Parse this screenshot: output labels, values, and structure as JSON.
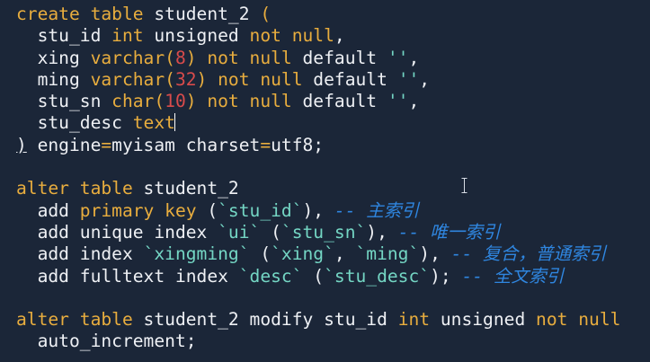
{
  "code": [
    [
      {
        "t": "create table",
        "c": "kw"
      },
      {
        "t": " student_2 ",
        "c": "tx"
      },
      {
        "t": "(",
        "c": "kw"
      }
    ],
    [
      {
        "t": "  stu_id ",
        "c": "tx"
      },
      {
        "t": "int",
        "c": "kw"
      },
      {
        "t": " unsigned ",
        "c": "tx"
      },
      {
        "t": "not null",
        "c": "kw"
      },
      {
        "t": ",",
        "c": "tx"
      }
    ],
    [
      {
        "t": "  xing ",
        "c": "tx"
      },
      {
        "t": "varchar(",
        "c": "kw"
      },
      {
        "t": "8",
        "c": "num"
      },
      {
        "t": ") ",
        "c": "kw"
      },
      {
        "t": "not null",
        "c": "kw"
      },
      {
        "t": " default ",
        "c": "tx"
      },
      {
        "t": "''",
        "c": "str"
      },
      {
        "t": ",",
        "c": "tx"
      }
    ],
    [
      {
        "t": "  ming ",
        "c": "tx"
      },
      {
        "t": "varchar(",
        "c": "kw"
      },
      {
        "t": "32",
        "c": "num"
      },
      {
        "t": ") ",
        "c": "kw"
      },
      {
        "t": "not null",
        "c": "kw"
      },
      {
        "t": " default ",
        "c": "tx"
      },
      {
        "t": "''",
        "c": "str"
      },
      {
        "t": ",",
        "c": "tx"
      }
    ],
    [
      {
        "t": "  stu_sn ",
        "c": "tx"
      },
      {
        "t": "char(",
        "c": "kw"
      },
      {
        "t": "10",
        "c": "num"
      },
      {
        "t": ") ",
        "c": "kw"
      },
      {
        "t": "not null",
        "c": "kw"
      },
      {
        "t": " default ",
        "c": "tx"
      },
      {
        "t": "''",
        "c": "str"
      },
      {
        "t": ",",
        "c": "tx"
      }
    ],
    [
      {
        "t": "  stu_desc ",
        "c": "tx"
      },
      {
        "t": "text",
        "c": "kw"
      },
      {
        "t": "",
        "c": "cursor"
      }
    ],
    [
      {
        "t": ")",
        "c": "tx",
        "u": true
      },
      {
        "t": " engine",
        "c": "tx"
      },
      {
        "t": "=",
        "c": "kw"
      },
      {
        "t": "myisam charset",
        "c": "tx"
      },
      {
        "t": "=",
        "c": "kw"
      },
      {
        "t": "utf8;",
        "c": "tx"
      }
    ],
    [],
    [
      {
        "t": "alter table",
        "c": "kw"
      },
      {
        "t": " student_2",
        "c": "tx"
      }
    ],
    [
      {
        "t": "  add ",
        "c": "tx"
      },
      {
        "t": "primary key",
        "c": "kw"
      },
      {
        "t": " (",
        "c": "tx"
      },
      {
        "t": "`stu_id`",
        "c": "str"
      },
      {
        "t": "), ",
        "c": "tx"
      },
      {
        "t": "-- 主索引",
        "c": "cm"
      }
    ],
    [
      {
        "t": "  add unique index ",
        "c": "tx"
      },
      {
        "t": "`ui`",
        "c": "str"
      },
      {
        "t": " (",
        "c": "tx"
      },
      {
        "t": "`stu_sn`",
        "c": "str"
      },
      {
        "t": "), ",
        "c": "tx"
      },
      {
        "t": "-- 唯一索引",
        "c": "cm"
      }
    ],
    [
      {
        "t": "  add index ",
        "c": "tx"
      },
      {
        "t": "`xingming`",
        "c": "str"
      },
      {
        "t": " (",
        "c": "tx"
      },
      {
        "t": "`xing`",
        "c": "str"
      },
      {
        "t": ", ",
        "c": "tx"
      },
      {
        "t": "`ming`",
        "c": "str"
      },
      {
        "t": "), ",
        "c": "tx"
      },
      {
        "t": "-- 复合，普通索引",
        "c": "cm"
      }
    ],
    [
      {
        "t": "  add fulltext index ",
        "c": "tx"
      },
      {
        "t": "`desc`",
        "c": "str"
      },
      {
        "t": " (",
        "c": "tx"
      },
      {
        "t": "`stu_desc`",
        "c": "str"
      },
      {
        "t": "); ",
        "c": "tx"
      },
      {
        "t": "-- 全文索引",
        "c": "cm"
      }
    ],
    [],
    [
      {
        "t": "alter table",
        "c": "kw"
      },
      {
        "t": " student_2 modify stu_id ",
        "c": "tx"
      },
      {
        "t": "int",
        "c": "kw"
      },
      {
        "t": " unsigned ",
        "c": "tx"
      },
      {
        "t": "not null",
        "c": "kw"
      }
    ],
    [
      {
        "t": "  auto_increment;",
        "c": "tx"
      }
    ]
  ],
  "colors": {
    "background": "#1b2638",
    "keyword": "#e8ad3e",
    "text": "#eef0f4",
    "number": "#d84b4b",
    "string": "#74d6c4",
    "comment": "#2f86e0"
  }
}
